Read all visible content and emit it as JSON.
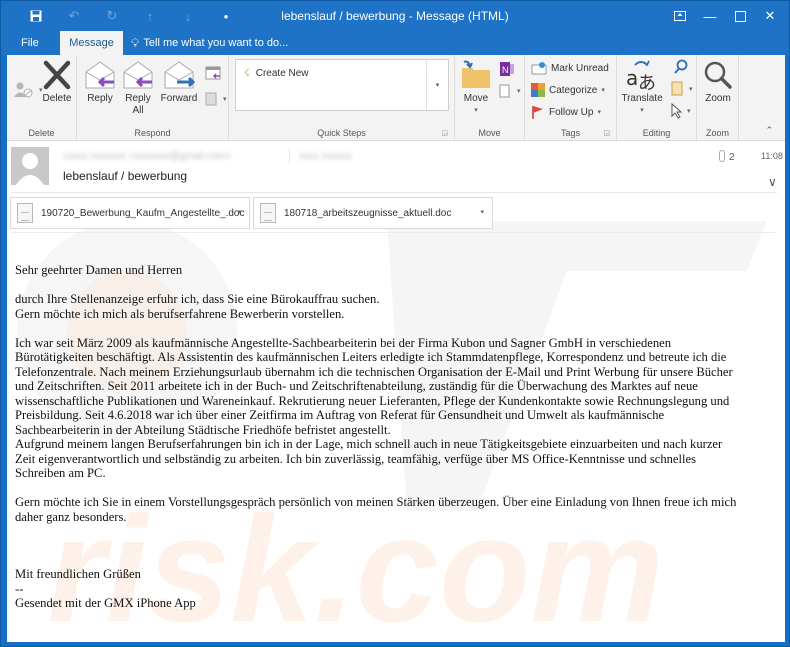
{
  "window": {
    "title": "lebenslauf / bewerbung  -  Message (HTML)",
    "controls": [
      "ribbon-display-options",
      "minimize",
      "maximize",
      "close"
    ]
  },
  "quick_access": [
    "save-icon",
    "undo-icon",
    "redo-icon",
    "previous-item-icon",
    "next-item-icon",
    "customize-icon"
  ],
  "tabs": {
    "file": "File",
    "message": "Message",
    "tell_me": "Tell me what you want to do..."
  },
  "ribbon": {
    "delete_group": {
      "label": "Delete",
      "delete": "Delete"
    },
    "respond_group": {
      "label": "Respond",
      "reply": "Reply",
      "reply_all_1": "Reply",
      "reply_all_2": "All",
      "forward": "Forward"
    },
    "quick_steps_group": {
      "label": "Quick Steps",
      "create_new": "Create New"
    },
    "move_group": {
      "label": "Move",
      "move": "Move"
    },
    "tags_group": {
      "label": "Tags",
      "mark_unread": "Mark Unread",
      "categorize": "Categorize",
      "follow_up": "Follow Up"
    },
    "editing_group": {
      "label": "Editing",
      "translate": "Translate"
    },
    "zoom_group": {
      "label": "Zoom",
      "zoom": "Zoom"
    }
  },
  "message": {
    "sender": "xxxxx xxxxxxx <xxxxxxx@gmail.com>",
    "recipient": "xxxx xxxxxx",
    "subject": "lebenslauf / bewerbung",
    "attachment_count": "2",
    "time": "11:08",
    "attachments": [
      {
        "name": "190720_Bewerbung_Kaufm_Angestellte_.doc"
      },
      {
        "name": "180718_arbeitszeugnisse_aktuell.doc"
      }
    ],
    "body": {
      "greeting": "Sehr geehrter Damen und Herren",
      "p1_l1": "durch Ihre Stellenanzeige erfuhr ich, dass Sie eine Bürokauffrau suchen.",
      "p1_l2": "Gern möchte ich mich als berufserfahrene Bewerberin vorstellen.",
      "p2_l1": "Ich war seit März 2009 als kaufmännische Angestellte-Sachbearbeiterin bei der Firma Kubon und Sagner GmbH in verschiedenen",
      "p2_l2": "Bürotätigkeiten beschäftigt. Als Assistentin des kaufmännischen Leiters erledigte ich Stammdatenpflege, Korrespondenz und betreute ich die",
      "p2_l3": "Telefonzentrale. Nach meinem Erziehungsurlaub übernahm ich die technischen Organisation der E-Mail und Print Werbung für unsere Bücher",
      "p2_l4": "und Zeitschriften. Seit 2011 arbeitete ich in der Buch- und Zeitschriftenabteilung, zuständig für die Überwachung des Marktes auf neue",
      "p2_l5": "wissenschaftliche Publikationen und Wareneinkauf. Rekrutierung neuer Lieferanten, Pflege der Kundenkontakte sowie Rechnungslegung und",
      "p2_l6": "Preisbildung. Seit 4.6.2018 war ich über einer Zeitfirma im Auftrag von Referat für Gensundheit und Umwelt als kaufmännische",
      "p2_l7": "Sachbearbeiterin in der Abteilung Städtische Friedhöfe befristet angestellt.",
      "p3_l1": "Aufgrund meinem langen Berufserfahrungen bin ich in der Lage, mich schnell auch in neue Tätigkeitsgebiete einzuarbeiten und nach kurzer",
      "p3_l2": "Zeit eigenverantwortlich und selbständig zu arbeiten. Ich bin zuverlässig, teamfähig, verfüge über MS Office-Kenntnisse und schnelles",
      "p3_l3": "Schreiben am PC.",
      "p4_l1": "Gern möchte ich Sie in einem Vorstellungsgespräch persönlich von meinen Stärken überzeugen. Über eine Einladung von Ihnen freue ich mich",
      "p4_l2": "daher ganz besonders.",
      "closing": "Mit freundlichen Grüßen",
      "sig_sep": "--",
      "signature": "Gesendet mit der GMX iPhone App"
    }
  },
  "colors": {
    "title_bar": "#1e73c6",
    "ribbon_bg": "#f3f3f3",
    "reply_arrow": "#8a4bbd",
    "forward_arrow": "#2f6fb5"
  }
}
